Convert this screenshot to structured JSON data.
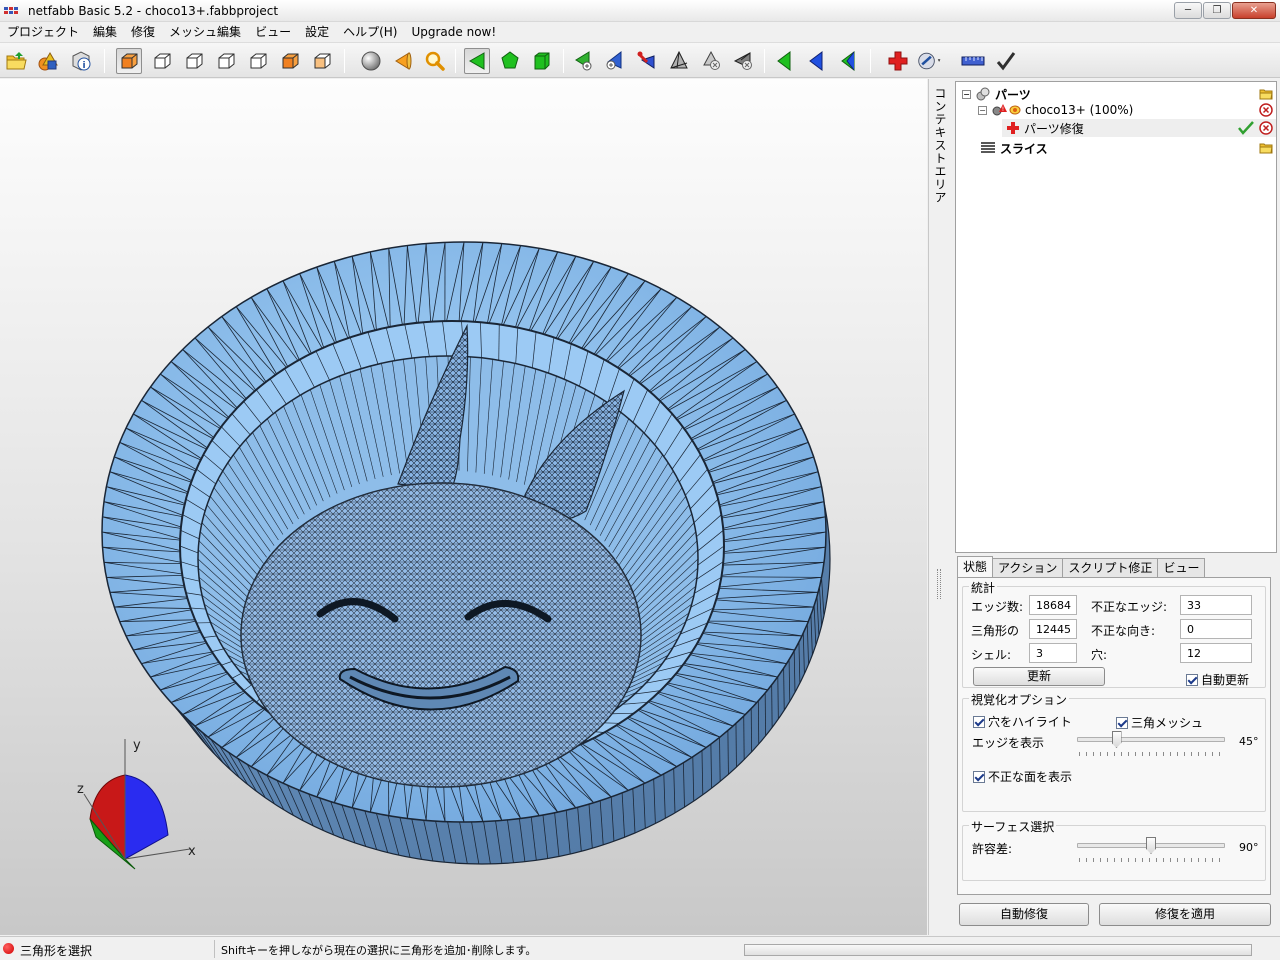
{
  "window": {
    "title": "netfabb Basic 5.2 - choco13+.fabbproject",
    "min_label": "─",
    "max_label": "❐",
    "close_label": "✕"
  },
  "menu": [
    "プロジェクト",
    "編集",
    "修復",
    "メッシュ編集",
    "ビュー",
    "設定",
    "ヘルプ(H)",
    "Upgrade now!"
  ],
  "toolbar": {
    "icons": [
      "open-folder-icon",
      "add-part-icon",
      "part-info-icon",
      "view-3d-icon",
      "view-front-icon",
      "view-back-icon",
      "view-left-icon",
      "view-right-icon",
      "view-top-icon",
      "view-bottom-icon",
      "sphere-icon",
      "cone-icon",
      "zoom-icon",
      "select-triangle-icon",
      "select-surface-icon",
      "select-shell-icon",
      "add-triangle-icon",
      "move-point-icon",
      "cut-triangle-icon",
      "tetrahedron-icon",
      "remove-triangle-icon",
      "close-holes-icon",
      "flip-normals-icon",
      "select-color-icon",
      "select-area-icon",
      "repair-icon",
      "view-mode-icon",
      "measure-icon",
      "apply-icon"
    ]
  },
  "viewport": {
    "axes": {
      "x": "x",
      "y": "y",
      "z": "z"
    },
    "mesh_color": "#8fc2f0",
    "edge_color": "#1e2a3a"
  },
  "context_area": {
    "label": "コンテキストエリア"
  },
  "tree": {
    "parts": {
      "label": "パーツ"
    },
    "part": {
      "label": "choco13+ (100%)"
    },
    "repair": {
      "label": "パーツ修復"
    },
    "slices": {
      "label": "スライス"
    }
  },
  "tabs": [
    "状態",
    "アクション",
    "スクリプト修正",
    "ビュー"
  ],
  "stats": {
    "title": "統計",
    "edges_label": "エッジ数:",
    "edges_value": "18684",
    "bad_edges_label": "不正なエッジ:",
    "bad_edges_value": "33",
    "triangles_label": "三角形の",
    "triangles_value": "12445",
    "bad_orient_label": "不正な向き:",
    "bad_orient_value": "0",
    "shells_label": "シェル:",
    "shells_value": "3",
    "holes_label": "穴:",
    "holes_value": "12",
    "update_button": "更新",
    "auto_update_label": "自動更新",
    "auto_update": true
  },
  "visualization": {
    "title": "視覚化オプション",
    "highlight_holes_label": "穴をハイライト",
    "triangle_mesh_label": "三角メッシュ",
    "show_edges_label": "エッジを表示",
    "edges_angle": 45,
    "edges_value_text": "45°",
    "show_bad_faces_label": "不正な面を表示"
  },
  "surface": {
    "title": "サーフェス選択",
    "tolerance_label": "許容差:",
    "tolerance": 90,
    "tolerance_value_text": "90°"
  },
  "buttons": {
    "auto_repair": "自動修復",
    "apply_repair": "修復を適用"
  },
  "status": {
    "mode": "三角形を選択",
    "hint": "Shiftキーを押しながら現在の選択に三角形を追加･削除します。"
  }
}
